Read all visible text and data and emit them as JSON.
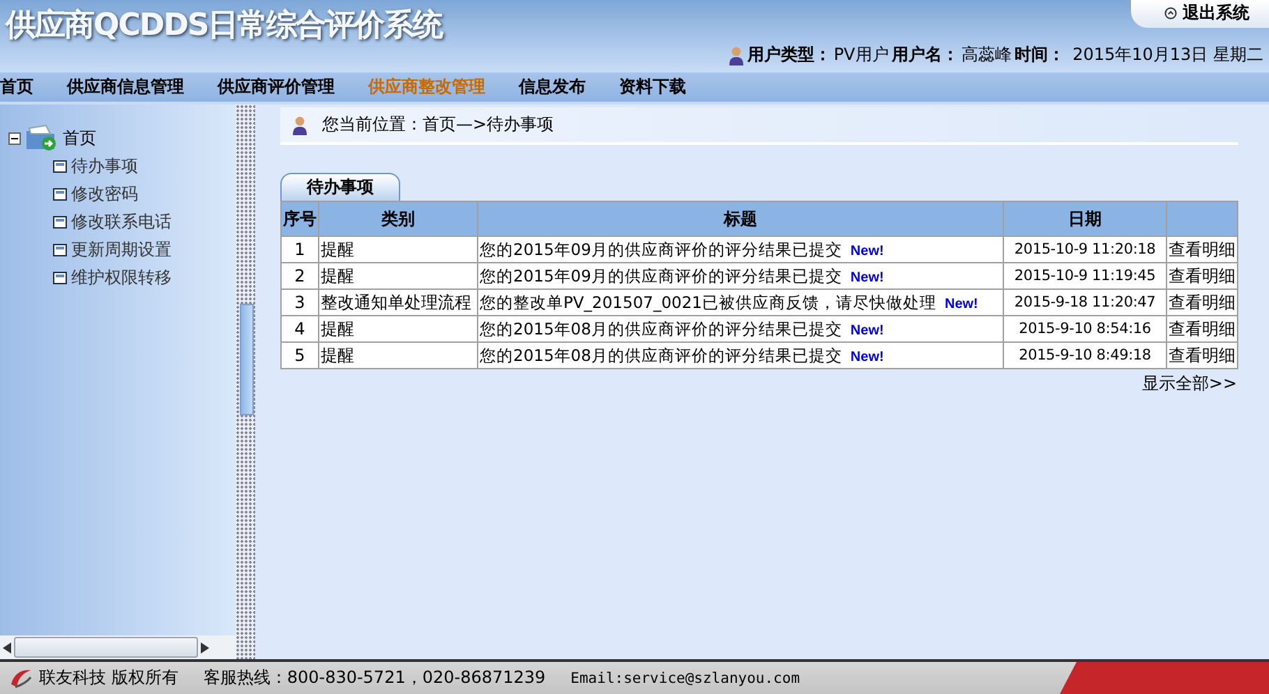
{
  "header": {
    "title": "供应商QCDDS日常综合评价系统",
    "logout": "退出系统",
    "user_type_label": "用户类型：",
    "user_type": "PV用户",
    "user_name_label": "用户名：",
    "user_name": "高蕊峰",
    "time_label": "时间：",
    "time": "2015年10月13日 星期二"
  },
  "nav": [
    {
      "label": "首页",
      "selected": false
    },
    {
      "label": "供应商信息管理",
      "selected": false
    },
    {
      "label": "供应商评价管理",
      "selected": false
    },
    {
      "label": "供应商整改管理",
      "selected": true
    },
    {
      "label": "信息发布",
      "selected": false
    },
    {
      "label": "资料下载",
      "selected": false
    }
  ],
  "sidebar": {
    "tree": [
      {
        "label": "首页",
        "expanded": true,
        "children": [
          {
            "label": "待办事项"
          },
          {
            "label": "修改密码"
          },
          {
            "label": "修改联系电话"
          },
          {
            "label": "更新周期设置"
          },
          {
            "label": "维护权限转移"
          }
        ]
      }
    ]
  },
  "breadcrumb": "您当前位置：首页—>待办事项",
  "tab": {
    "label": "待办事项"
  },
  "table": {
    "columns": [
      "序号",
      "类别",
      "标题",
      "日期"
    ],
    "rows": [
      {
        "index": "1",
        "category": "提醒",
        "title": "您的2015年09月的供应商评价的评分结果已提交",
        "badge": "New!",
        "date": "2015-10-9 11:20:18",
        "action": "查看明细"
      },
      {
        "index": "2",
        "category": "提醒",
        "title": "您的2015年09月的供应商评价的评分结果已提交",
        "badge": "New!",
        "date": "2015-10-9 11:19:45",
        "action": "查看明细"
      },
      {
        "index": "3",
        "category": "整改通知单处理流程",
        "title": "您的整改单PV_201507_0021已被供应商反馈，请尽快做处理",
        "badge": "New!",
        "date": "2015-9-18 11:20:47",
        "action": "查看明细"
      },
      {
        "index": "4",
        "category": "提醒",
        "title": "您的2015年08月的供应商评价的评分结果已提交",
        "badge": "New!",
        "date": "2015-9-10 8:54:16",
        "action": "查看明细"
      },
      {
        "index": "5",
        "category": "提醒",
        "title": "您的2015年08月的供应商评价的评分结果已提交",
        "badge": "New!",
        "date": "2015-9-10 8:49:18",
        "action": "查看明细"
      }
    ]
  },
  "show_all": "显示全部>>",
  "footer": {
    "company": "联友科技 版权所有",
    "hotline": "客服热线：800-830-5721，020-86871239",
    "email": "Email:service@szlanyou.com"
  }
}
